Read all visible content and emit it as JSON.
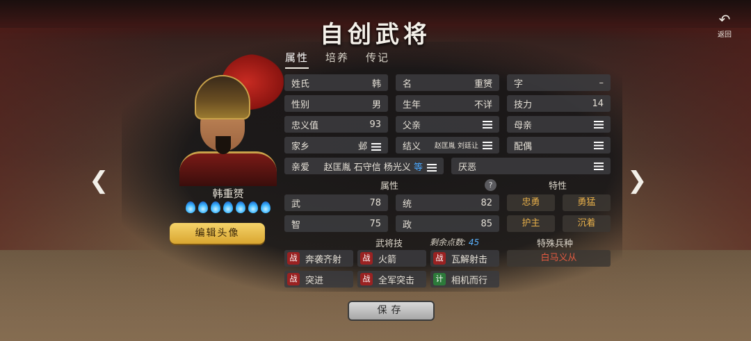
{
  "title": "自创武将",
  "back": {
    "label": "返回"
  },
  "tabs": [
    {
      "label": "属性",
      "active": true
    },
    {
      "label": "培养",
      "active": false
    },
    {
      "label": "传记",
      "active": false
    }
  ],
  "hero": {
    "name": "韩重赟",
    "stars": 7,
    "edit_label": "编辑头像"
  },
  "fields": {
    "surname": {
      "label": "姓氏",
      "value": "韩"
    },
    "given": {
      "label": "名",
      "value": "重赟"
    },
    "courtesy": {
      "label": "字",
      "value": "–"
    },
    "gender": {
      "label": "性别",
      "value": "男"
    },
    "birth": {
      "label": "生年",
      "value": "不详"
    },
    "skill_power": {
      "label": "技力",
      "value": "14"
    },
    "loyalty": {
      "label": "忠义值",
      "value": "93"
    },
    "father": {
      "label": "父亲"
    },
    "mother": {
      "label": "母亲"
    },
    "hometown": {
      "label": "家乡",
      "value": "邺"
    },
    "sworn": {
      "label": "结义",
      "value": "赵匡胤 刘廷让"
    },
    "spouse": {
      "label": "配偶"
    },
    "close": {
      "label": "亲爱",
      "value": "赵匡胤 石守信 杨光义",
      "suffix": "等"
    },
    "dislike": {
      "label": "厌恶"
    }
  },
  "attributes": {
    "header": "属性",
    "help": "?",
    "items": [
      {
        "label": "武",
        "value": "78"
      },
      {
        "label": "统",
        "value": "82"
      },
      {
        "label": "智",
        "value": "75"
      },
      {
        "label": "政",
        "value": "85"
      }
    ]
  },
  "traits": {
    "header": "特性",
    "items": [
      "忠勇",
      "勇猛",
      "护主",
      "沉着"
    ]
  },
  "skills": {
    "header": "武将技",
    "points_label": "剩余点数:",
    "points_value": "45",
    "items": [
      {
        "tag": "战",
        "name": "奔袭齐射"
      },
      {
        "tag": "战",
        "name": "火箭"
      },
      {
        "tag": "战",
        "name": "瓦解射击"
      },
      {
        "tag": "战",
        "name": "突进"
      },
      {
        "tag": "战",
        "name": "全军突击"
      },
      {
        "tag": "计",
        "name": "相机而行"
      }
    ]
  },
  "special_troop": {
    "header": "特殊兵种",
    "value": "白马义从"
  },
  "save_label": "保存",
  "nav": {
    "prev": "❮",
    "next": "❯"
  },
  "colors": {
    "accent": "#f5d36a",
    "trait": "#e8b04a",
    "special": "#e35a40",
    "points": "#5ab2ff"
  }
}
